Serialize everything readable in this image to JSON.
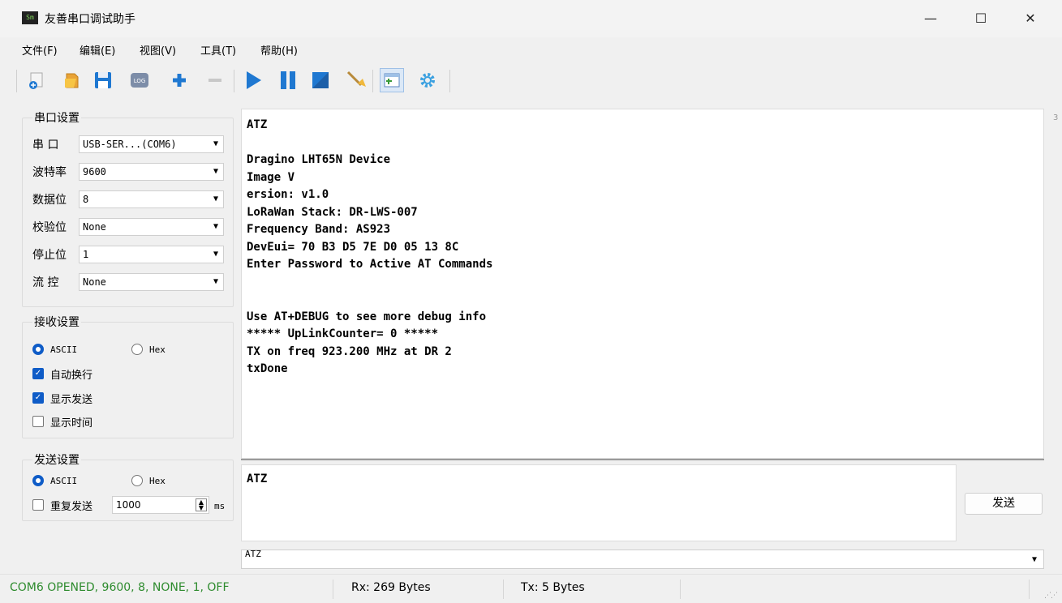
{
  "window": {
    "title": "友善串口调试助手",
    "app_icon_text": "Sm",
    "controls": {
      "minimize": "—",
      "maximize": "☐",
      "close": "✕"
    }
  },
  "menu": [
    "文件(F)",
    "编辑(E)",
    "视图(V)",
    "工具(T)",
    "帮助(H)"
  ],
  "toolbar": {
    "log_label": "LOG",
    "icons": [
      "new-session-icon",
      "open-file-icon",
      "save-icon",
      "log-icon",
      "add-icon",
      "remove-icon",
      "start-icon",
      "pause-icon",
      "stop-icon",
      "clear-icon",
      "add-window-icon",
      "settings-icon"
    ]
  },
  "serial_settings": {
    "title": "串口设置",
    "rows": [
      {
        "label": "串  口",
        "value": "USB-SER...(COM6)"
      },
      {
        "label": "波特率",
        "value": "9600"
      },
      {
        "label": "数据位",
        "value": "8"
      },
      {
        "label": "校验位",
        "value": "None"
      },
      {
        "label": "停止位",
        "value": "1"
      },
      {
        "label": "流  控",
        "value": "None"
      }
    ]
  },
  "receive_settings": {
    "title": "接收设置",
    "ascii_label": "ASCII",
    "hex_label": "Hex",
    "mode": "ASCII",
    "auto_wrap_label": "自动换行",
    "auto_wrap": true,
    "show_sent_label": "显示发送",
    "show_sent": true,
    "show_time_label": "显示时间",
    "show_time": false
  },
  "send_settings": {
    "title": "发送设置",
    "ascii_label": "ASCII",
    "hex_label": "Hex",
    "mode": "ASCII",
    "repeat_label": "重复发送",
    "repeat": false,
    "interval": "1000",
    "interval_unit": "ms"
  },
  "receive_text": "ATZ\n\nDragino LHT65N Device\nImage V\nersion: v1.0\nLoRaWan Stack: DR-LWS-007\nFrequency Band: AS923\nDevEui= 70 B3 D5 7E D0 05 13 8C\nEnter Password to Active AT Commands\n\n\nUse AT+DEBUG to see more debug info\n***** UpLinkCounter= 0 *****\nTX on freq 923.200 MHz at DR 2\ntxDone",
  "send_input": "ATZ",
  "send_button": "发送",
  "history_value": "ATZ",
  "status": {
    "port_state": "COM6 OPENED, 9600, 8, NONE, 1, OFF",
    "port_state_color": "#2e8b2e",
    "rx": "Rx: 269 Bytes",
    "tx": "Tx: 5 Bytes"
  },
  "colors": {
    "accent": "#0f5cc7",
    "toolbar_blue": "#1f78d1"
  }
}
